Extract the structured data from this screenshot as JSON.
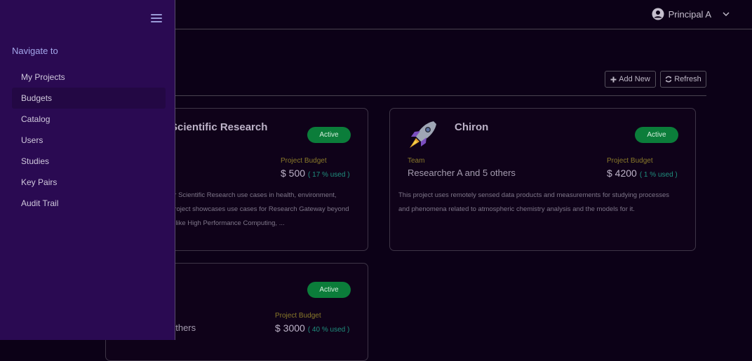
{
  "header": {
    "user_name": "Principal A"
  },
  "toolbar": {
    "add_label": "Add New",
    "refresh_label": "Refresh"
  },
  "sidebar": {
    "title": "Navigate to",
    "items": [
      {
        "label": "My Projects"
      },
      {
        "label": "Budgets",
        "active": true
      },
      {
        "label": "Catalog"
      },
      {
        "label": "Users"
      },
      {
        "label": "Studies"
      },
      {
        "label": "Key Pairs"
      },
      {
        "label": "Audit Trail"
      }
    ]
  },
  "projects": [
    {
      "title": "Scientific Research",
      "status": "Active",
      "budget_label": "Project Budget",
      "budget": "$ 500",
      "used": "( 17 % used )",
      "description_lines": [
        "or Scientific Research use cases in health, environment,",
        "project showcases use cases for Research Gateway beyond",
        "s like High Performance Computing, ..."
      ]
    },
    {
      "title": "Chiron",
      "status": "Active",
      "team_label": "Team",
      "team": "Researcher A and 5 others",
      "budget_label": "Project Budget",
      "budget": "$ 4200",
      "used": "( 1 % used )",
      "description_lines": [
        "This project uses remotely sensed data products and measurements for studying processes",
        "and phenomena related to atmospheric chemistry analysis and the models for it."
      ],
      "icon": "rocket-icon"
    },
    {
      "title": "",
      "status": "Active",
      "team": "others",
      "budget_label": "Project Budget",
      "budget": "$ 3000",
      "used": "( 40 % used )"
    }
  ],
  "colors": {
    "sidebar_bg": "#2a0a52",
    "page_bg": "#0c0117",
    "active_badge": "#0b7d3a",
    "budget_label": "#8a7a2a",
    "used_text": "#1f8f7e"
  }
}
